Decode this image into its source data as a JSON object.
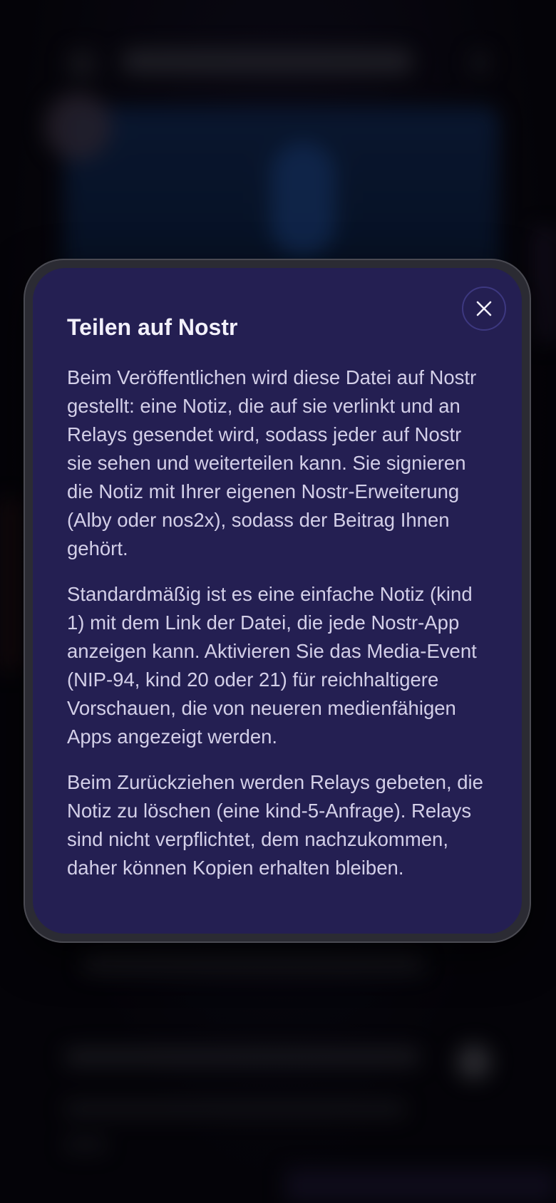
{
  "dialog": {
    "title": "Teilen auf Nostr",
    "close_icon": "close-icon",
    "paragraphs": [
      "Beim Veröffentlichen wird diese Datei auf Nostr gestellt: eine Notiz, die auf sie verlinkt und an Relays gesendet wird, sodass jeder auf Nostr sie sehen und weiterteilen kann. Sie signieren die Notiz mit Ihrer eigenen Nostr-Erweiterung (Alby oder nos2x), sodass der Beitrag Ihnen gehört.",
      "Standardmäßig ist es eine einfache Notiz (kind 1) mit dem Link der Datei, die jede Nostr-App anzeigen kann. Aktivieren Sie das Media-Event (NIP-94, kind 20 oder 21) für reichhaltigere Vorschauen, die von neueren medienfähigen Apps angezeigt werden.",
      "Beim Zurückziehen werden Relays gebeten, die Notiz zu löschen (eine kind-5-Anfrage). Relays sind nicht verpflichtet, dem nachzukommen, daher können Kopien erhalten bleiben."
    ]
  },
  "colors": {
    "dialog_background": "#241f52",
    "dialog_frame": "#2b2b33",
    "title_text": "#f2f0fa",
    "body_text": "#d3cfe8",
    "close_border": "#3d3880"
  }
}
